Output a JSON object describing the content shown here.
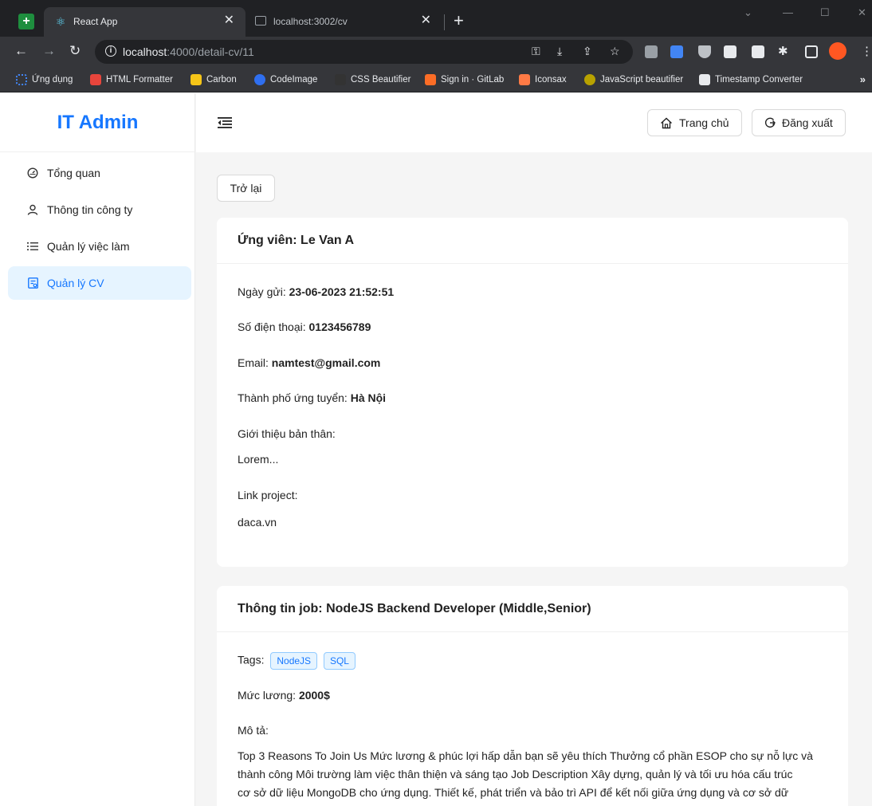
{
  "browser": {
    "tabs": [
      {
        "title": "React App",
        "active": true
      },
      {
        "title": "localhost:3002/cv",
        "active": false
      }
    ],
    "url_host": "localhost",
    "url_path": ":4000/detail-cv/11",
    "bookmarks": [
      {
        "label": "Ứng dụng",
        "color": "#4285f4"
      },
      {
        "label": "HTML Formatter",
        "color": "#e8453c"
      },
      {
        "label": "Carbon",
        "color": "#f5c518"
      },
      {
        "label": "CodeImage",
        "color": "#2f6ff0"
      },
      {
        "label": "CSS Beautifier",
        "color": "#333333"
      },
      {
        "label": "Sign in · GitLab",
        "color": "#fc6d26"
      },
      {
        "label": "Iconsax",
        "color": "#ff7a45"
      },
      {
        "label": "JavaScript beautifier",
        "color": "#b8a200"
      },
      {
        "label": "Timestamp Converter",
        "color": "#e8eaed"
      }
    ]
  },
  "sidebar": {
    "logo": "IT Admin",
    "items": [
      {
        "label": "Tổng quan",
        "icon": "dashboard-icon",
        "active": false
      },
      {
        "label": "Thông tin công ty",
        "icon": "user-icon",
        "active": false
      },
      {
        "label": "Quản lý việc làm",
        "icon": "list-icon",
        "active": false
      },
      {
        "label": "Quản lý CV",
        "icon": "file-icon",
        "active": true
      }
    ]
  },
  "header": {
    "home_label": "Trang chủ",
    "logout_label": "Đăng xuất"
  },
  "content": {
    "back_label": "Trở lại",
    "candidate": {
      "title": "Ứng viên: Le Van A",
      "date_label": "Ngày gửi:",
      "date_value": "23-06-2023 21:52:51",
      "phone_label": "Số điện thoại:",
      "phone_value": "0123456789",
      "email_label": "Email:",
      "email_value": "namtest@gmail.com",
      "city_label": "Thành phố ứng tuyển:",
      "city_value": "Hà Nội",
      "intro_label": "Giới thiệu bản thân:",
      "intro_value": "Lorem...",
      "project_label": "Link project:",
      "project_value": "daca.vn"
    },
    "job": {
      "title": "Thông tin job: NodeJS Backend Developer (Middle,Senior)",
      "tags_label": "Tags:",
      "tags": [
        "NodeJS",
        "SQL"
      ],
      "salary_label": "Mức lương:",
      "salary_value": "2000$",
      "desc_label": "Mô tả:",
      "desc_lines": [
        "Top 3 Reasons To Join Us Mức lương & phúc lợi hấp dẫn bạn sẽ yêu thích Thưởng cổ phần ESOP cho sự nỗ lực và",
        "thành công Môi trường làm việc thân thiện và sáng tạo Job Description Xây dựng, quản lý và tối ưu hóa cấu trúc",
        "cơ sở dữ liệu MongoDB cho ứng dụng. Thiết kế, phát triển và bảo trì API để kết nối giữa ứng dụng và cơ sở dữ"
      ]
    }
  }
}
